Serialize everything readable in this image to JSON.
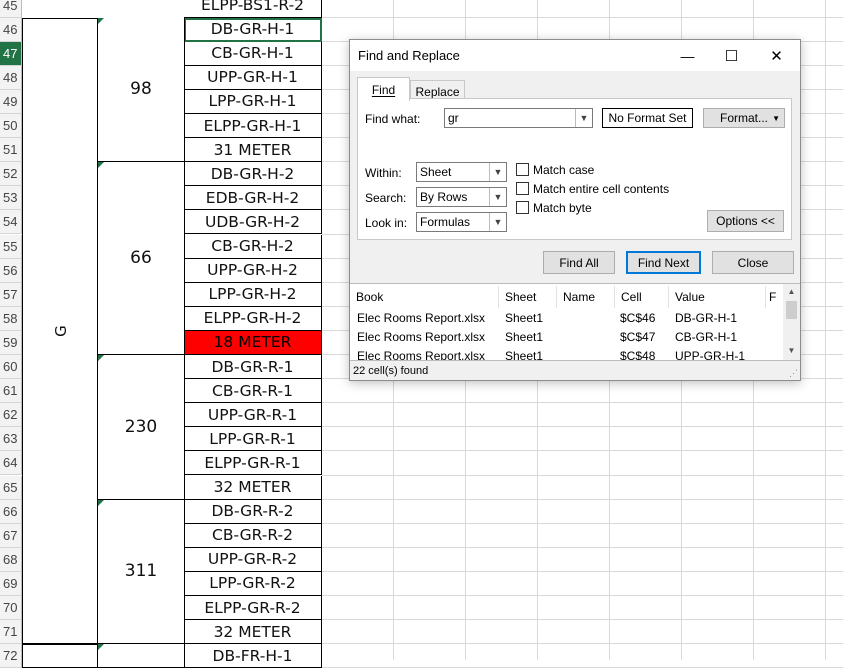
{
  "sheet": {
    "rows": [
      {
        "num": "45",
        "c": "ELPP-BS1-R-2"
      },
      {
        "num": "46",
        "c": "DB-GR-H-1"
      },
      {
        "num": "47",
        "c": "CB-GR-H-1"
      },
      {
        "num": "48",
        "c": "UPP-GR-H-1"
      },
      {
        "num": "49",
        "c": "LPP-GR-H-1"
      },
      {
        "num": "50",
        "c": "ELPP-GR-H-1"
      },
      {
        "num": "51",
        "c": "31 METER"
      },
      {
        "num": "52",
        "c": "DB-GR-H-2"
      },
      {
        "num": "53",
        "c": "EDB-GR-H-2"
      },
      {
        "num": "54",
        "c": "UDB-GR-H-2"
      },
      {
        "num": "55",
        "c": "CB-GR-H-2"
      },
      {
        "num": "56",
        "c": "UPP-GR-H-2"
      },
      {
        "num": "57",
        "c": "LPP-GR-H-2"
      },
      {
        "num": "58",
        "c": "ELPP-GR-H-2"
      },
      {
        "num": "59",
        "c": "18 METER"
      },
      {
        "num": "60",
        "c": "DB-GR-R-1"
      },
      {
        "num": "61",
        "c": "CB-GR-R-1"
      },
      {
        "num": "62",
        "c": "UPP-GR-R-1"
      },
      {
        "num": "63",
        "c": "LPP-GR-R-1"
      },
      {
        "num": "64",
        "c": "ELPP-GR-R-1"
      },
      {
        "num": "65",
        "c": "32 METER"
      },
      {
        "num": "66",
        "c": "DB-GR-R-2"
      },
      {
        "num": "67",
        "c": "CB-GR-R-2"
      },
      {
        "num": "68",
        "c": "UPP-GR-R-2"
      },
      {
        "num": "69",
        "c": "LPP-GR-R-2"
      },
      {
        "num": "70",
        "c": "ELPP-GR-R-2"
      },
      {
        "num": "71",
        "c": "32 METER"
      },
      {
        "num": "72",
        "c": "DB-FR-H-1"
      }
    ],
    "b_blocks": [
      "98",
      "66",
      "230",
      "311"
    ],
    "a_block": "G",
    "selected_row": "47",
    "highlight_color": "#ff0000",
    "selection_color": "#217346"
  },
  "dialog": {
    "title": "Find and Replace",
    "minimize_glyph": "—",
    "maximize_glyph": "☐",
    "close_glyph": "✕",
    "tabs": [
      "Find",
      "Replace"
    ],
    "find_what_label": "Find what:",
    "find_what_value": "gr",
    "no_format_label": "No Format Set",
    "format_button": "Format...",
    "within_label": "Within:",
    "within_value": "Sheet",
    "search_label": "Search:",
    "search_value": "By Rows",
    "lookin_label": "Look in:",
    "lookin_value": "Formulas",
    "match_case": "Match case",
    "match_entire": "Match entire cell contents",
    "match_byte": "Match byte",
    "options_button": "Options <<",
    "find_all_button": "Find All",
    "find_next_button": "Find Next",
    "close_button": "Close",
    "results": {
      "columns": [
        "Book",
        "Sheet",
        "Name",
        "Cell",
        "Value",
        "F"
      ],
      "rows": [
        {
          "book": "Elec Rooms Report.xlsx",
          "sheet": "Sheet1",
          "name": "",
          "cell": "$C$46",
          "value": "DB-GR-H-1"
        },
        {
          "book": "Elec Rooms Report.xlsx",
          "sheet": "Sheet1",
          "name": "",
          "cell": "$C$47",
          "value": "CB-GR-H-1"
        },
        {
          "book": "Elec Rooms Report.xlsx",
          "sheet": "Sheet1",
          "name": "",
          "cell": "$C$48",
          "value": "UPP-GR-H-1"
        }
      ]
    },
    "status": "22 cell(s) found"
  }
}
